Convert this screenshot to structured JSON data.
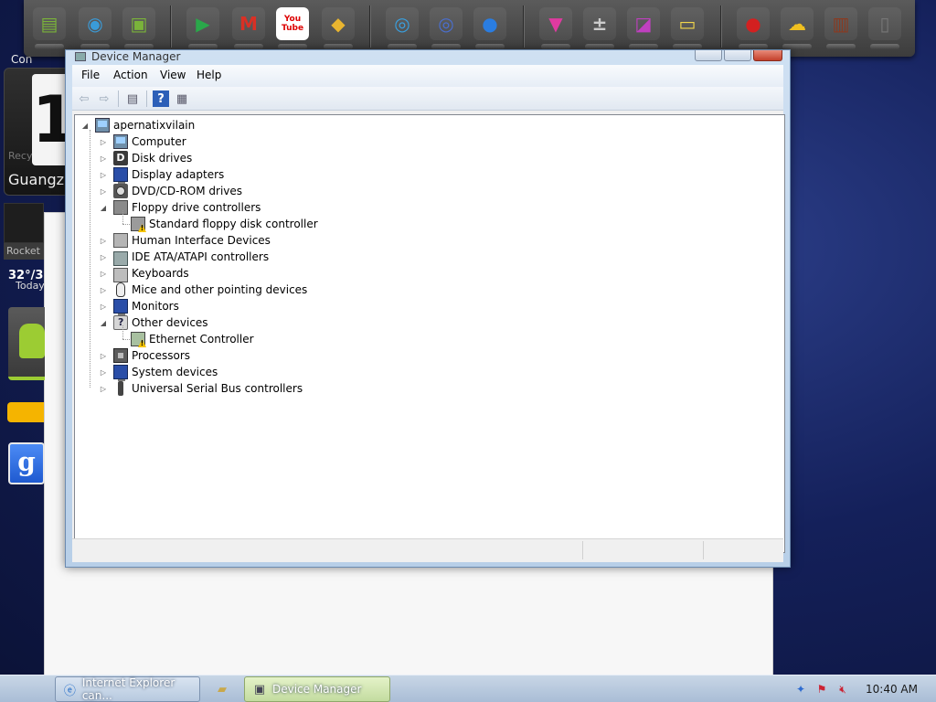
{
  "desktop_widgets": {
    "clock_digit": "1",
    "label_top": "Con",
    "recycle_label": "Recy",
    "city": "Guangzh",
    "rocket_label": "Rocket",
    "temperature": "32°/3",
    "day": "Today",
    "google_letter": "g"
  },
  "dock": {
    "icons": [
      {
        "name": "android-screen-icon",
        "glyph": "▤",
        "color": "#7ab33a"
      },
      {
        "name": "android-globe-icon",
        "glyph": "◉",
        "color": "#3a9bd8"
      },
      {
        "name": "android-folder-icon",
        "glyph": "▣",
        "color": "#7ab33a"
      },
      {
        "name": "play-store-icon",
        "glyph": "▶",
        "color": "#2aa84a"
      },
      {
        "name": "gmail-icon",
        "glyph": "M",
        "color": "#d93025"
      },
      {
        "name": "youtube-icon",
        "glyph": "You Tube",
        "color": "#d00"
      },
      {
        "name": "maps-icon",
        "glyph": "◆",
        "color": "#e9b530"
      },
      {
        "name": "speaker-icon",
        "glyph": "◎",
        "color": "#39a0e0"
      },
      {
        "name": "music-icon",
        "glyph": "◎",
        "color": "#4a6fd0"
      },
      {
        "name": "browser-globe-icon",
        "glyph": "●",
        "color": "#2a7de1"
      },
      {
        "name": "color-picker-icon",
        "glyph": "▼",
        "color": "#e03aa0"
      },
      {
        "name": "calculator-icon",
        "glyph": "±",
        "color": "#ccc"
      },
      {
        "name": "gallery-icon",
        "glyph": "◪",
        "color": "#c040c0"
      },
      {
        "name": "notes-icon",
        "glyph": "▭",
        "color": "#f2d64b"
      },
      {
        "name": "angry-birds-icon",
        "glyph": "●",
        "color": "#d32020"
      },
      {
        "name": "weather-icon",
        "glyph": "☁",
        "color": "#f0c020"
      },
      {
        "name": "android-bot-icon",
        "glyph": "▥",
        "color": "#8a3a20"
      },
      {
        "name": "trash-icon",
        "glyph": "▯",
        "color": "#777"
      }
    ]
  },
  "window": {
    "title": "Device Manager",
    "menu": [
      "File",
      "Action",
      "View",
      "Help"
    ]
  },
  "tree": {
    "root": "apernatixvilain",
    "nodes": [
      {
        "label": "Computer",
        "expanded": false,
        "icon": "comp"
      },
      {
        "label": "Disk drives",
        "expanded": false,
        "icon": "disk"
      },
      {
        "label": "Display adapters",
        "expanded": false,
        "icon": "monitor"
      },
      {
        "label": "DVD/CD-ROM drives",
        "expanded": false,
        "icon": "dvd"
      },
      {
        "label": "Floppy drive controllers",
        "expanded": true,
        "icon": "floppy",
        "children": [
          {
            "label": "Standard floppy disk controller",
            "icon": "floppy-warn"
          }
        ]
      },
      {
        "label": "Human Interface Devices",
        "expanded": false,
        "icon": "hid"
      },
      {
        "label": "IDE ATA/ATAPI controllers",
        "expanded": false,
        "icon": "ide"
      },
      {
        "label": "Keyboards",
        "expanded": false,
        "icon": "kbd"
      },
      {
        "label": "Mice and other pointing devices",
        "expanded": false,
        "icon": "mouse"
      },
      {
        "label": "Monitors",
        "expanded": false,
        "icon": "monitor"
      },
      {
        "label": "Other devices",
        "expanded": true,
        "icon": "other",
        "children": [
          {
            "label": "Ethernet Controller",
            "icon": "eth-warn"
          }
        ]
      },
      {
        "label": "Processors",
        "expanded": false,
        "icon": "cpu"
      },
      {
        "label": "System devices",
        "expanded": false,
        "icon": "monitor"
      },
      {
        "label": "Universal Serial Bus controllers",
        "expanded": false,
        "icon": "usb"
      }
    ]
  },
  "taskbar": {
    "tasks": [
      {
        "label": "Internet Explorer can...",
        "icon": "ie-icon",
        "active": false
      },
      {
        "label": "Device Manager",
        "icon": "device-manager-icon",
        "active": true
      }
    ],
    "clock": "10:40 AM"
  },
  "colors": {
    "desktop_blue": "#14205a",
    "window_chrome": "#b8cfe8",
    "active_task": "#c3dca0"
  }
}
